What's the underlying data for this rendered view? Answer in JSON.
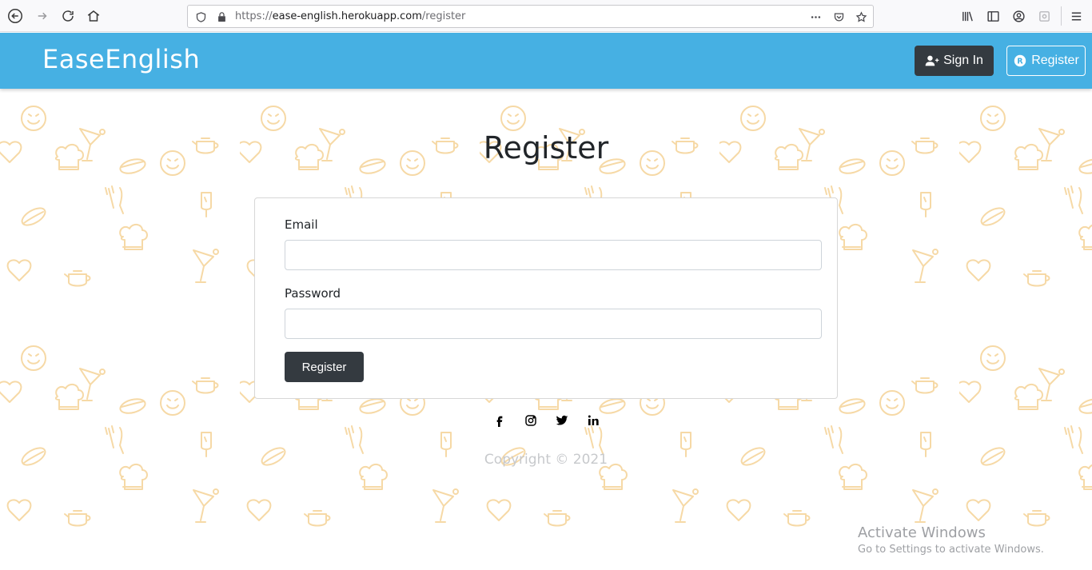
{
  "browser": {
    "url_prefix": "https://",
    "url_host": "ease-english.herokuapp.com",
    "url_path": "/register"
  },
  "navbar": {
    "brand": "EaseEnglish",
    "signin_label": "Sign In",
    "register_label": "Register"
  },
  "page": {
    "title": "Register"
  },
  "form": {
    "email_label": "Email",
    "email_value": "",
    "password_label": "Password",
    "password_value": "",
    "submit_label": "Register"
  },
  "social": [
    "facebook-icon",
    "instagram-icon",
    "twitter-icon",
    "linkedin-icon"
  ],
  "footer": {
    "copyright": "Copyright © 2021"
  },
  "watermark": {
    "title": "Activate Windows",
    "subtitle": "Go to Settings to activate Windows."
  },
  "colors": {
    "navbar": "#46b0e3",
    "dark_button": "#343a40",
    "pattern": "#f6d9a6"
  }
}
